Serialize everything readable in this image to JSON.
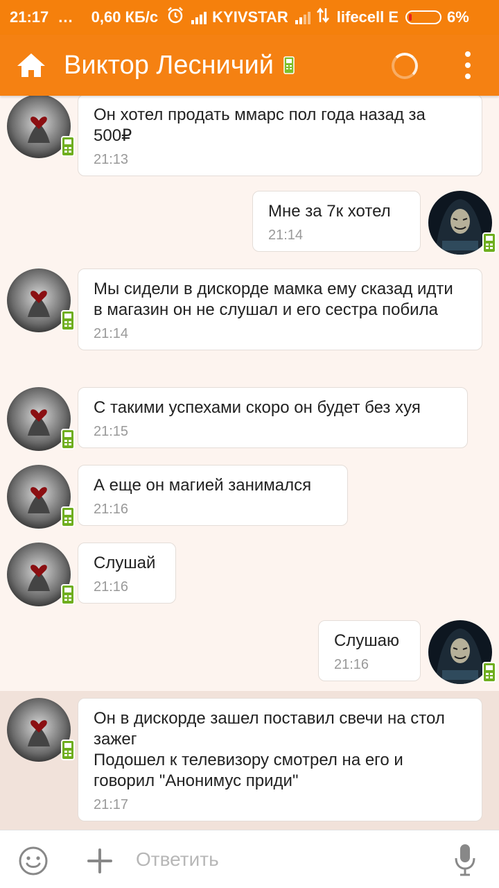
{
  "status_bar": {
    "time": "21:17",
    "dots": "...",
    "speed": "0,60 КБ/с",
    "carrier1": "KYIVSTAR",
    "carrier2": "lifecell E",
    "battery": "6%",
    "battery_level": 0.06
  },
  "header": {
    "title": "Виктор Лесничий",
    "icons": {
      "home": "home-icon",
      "mobile": "mobile-phone-icon",
      "loading": "loading-spinner-icon",
      "more": "more-vertical-icon"
    }
  },
  "messages": [
    {
      "side": "incoming",
      "text": "Он хотел продать ммарс пол года назад за 500₽",
      "time": "21:13"
    },
    {
      "side": "outgoing",
      "text": "Мне за 7к хотел",
      "time": "21:14"
    },
    {
      "side": "incoming",
      "text": "Мы сидели в дискорде мамка ему сказад идти в магазин он не слушал и его сестра побила",
      "time": "21:14"
    },
    {
      "side": "incoming",
      "text": "С такими успехами скоро он будет без хуя",
      "time": "21:15"
    },
    {
      "side": "incoming",
      "text": "А еще он магией занимался",
      "time": "21:16"
    },
    {
      "side": "incoming",
      "text": "Слушай",
      "time": "21:16"
    },
    {
      "side": "outgoing",
      "text": "Слушаю",
      "time": "21:16"
    },
    {
      "side": "incoming",
      "text": "Он в дискорде зашел поставил свечи на стол зажег\nПодошел к телевизору смотрел на его и говорил \"Анонимус приди\"",
      "time": "21:17"
    }
  ],
  "composer": {
    "placeholder": "Ответить",
    "icons": {
      "emoji": "emoji-icon",
      "add": "plus-icon",
      "mic": "microphone-icon"
    }
  },
  "colors": {
    "accent": "#f58112",
    "badge_green": "#6fae1e",
    "background": "#fdf4ef",
    "highlight": "#f1e2da"
  }
}
